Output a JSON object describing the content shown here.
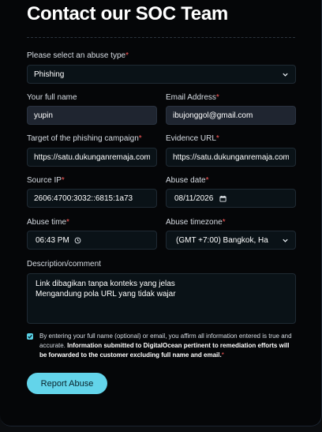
{
  "page": {
    "title": "Contact our SOC Team"
  },
  "form": {
    "abuse_type": {
      "label": "Please select an abuse type",
      "value": "Phishing"
    },
    "full_name": {
      "label": "Your full name",
      "value": "yupin"
    },
    "email": {
      "label": "Email Address",
      "value": "ibujonggol@gmail.com"
    },
    "target": {
      "label": "Target of the phishing campaign",
      "value": "https://satu.dukunganremaja.com"
    },
    "evidence": {
      "label": "Evidence URL",
      "value": "https://satu.dukunganremaja.com"
    },
    "source_ip": {
      "label": "Source IP",
      "value": "2606:4700:3032::6815:1a73"
    },
    "abuse_date": {
      "label": "Abuse date",
      "value": "08/11/2026"
    },
    "abuse_time": {
      "label": "Abuse time",
      "value": "06:43 PM"
    },
    "timezone": {
      "label": "Abuse timezone",
      "value": "(GMT +7:00) Bangkok, Ha"
    },
    "description": {
      "label": "Description/comment",
      "lines": [
        "Link dibagikan tanpa konteks yang jelas",
        "Mengandung pola URL yang tidak wajar"
      ]
    },
    "required_mark": "*",
    "consent": {
      "checked": true,
      "text": "By entering your full name (optional) or email, you affirm all information entered is true and accurate.",
      "bold_text": "Information submitted to DigitalOcean pertinent to remediation efforts will be forwarded to the customer excluding full name and email."
    },
    "submit_label": "Report Abuse"
  },
  "colors": {
    "accent": "#63d4ea",
    "required": "#ff5b5b",
    "background": "#050608"
  },
  "icons": {
    "select": "chevron-down-icon",
    "time": "clock-icon",
    "date": "calendar-icon",
    "check": "check-icon"
  }
}
